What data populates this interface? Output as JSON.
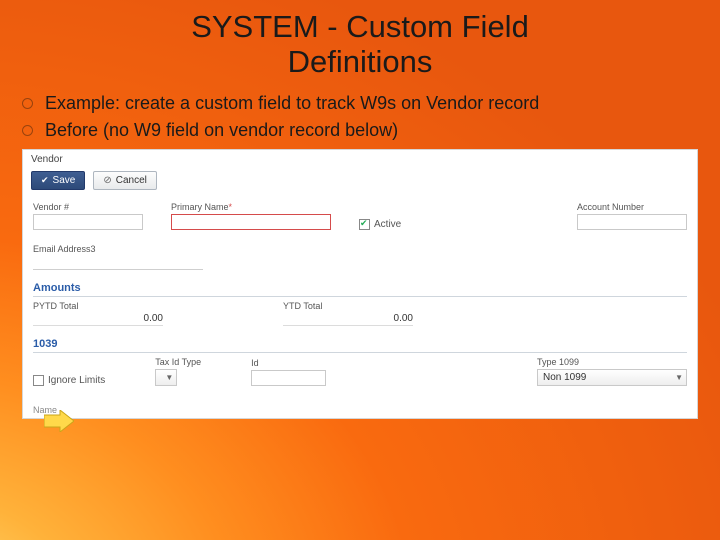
{
  "title_line1": "SYSTEM - Custom Field",
  "title_line2": "Definitions",
  "bullets": [
    "Example: create a custom field to track W9s on Vendor record",
    "Before (no W9 field on vendor record below)"
  ],
  "panel": {
    "header": "Vendor",
    "save": "Save",
    "cancel": "Cancel",
    "row1": {
      "vendor_num": "Vendor #",
      "primary_name": "Primary Name",
      "star": "*",
      "active": "Active",
      "account_num": "Account Number"
    },
    "row2": {
      "email": "Email Address3"
    },
    "amounts": {
      "heading": "Amounts",
      "pytd_label": "PYTD Total",
      "pytd_value": "0.00",
      "ytd_label": "YTD Total",
      "ytd_value": "0.00"
    },
    "sec1099": {
      "heading": "1039",
      "ignore": "Ignore Limits",
      "taxidtype": "Tax Id Type",
      "id": "Id",
      "type1099": "Type 1099",
      "type1099_value": "Non 1099"
    },
    "footer": "Name"
  }
}
